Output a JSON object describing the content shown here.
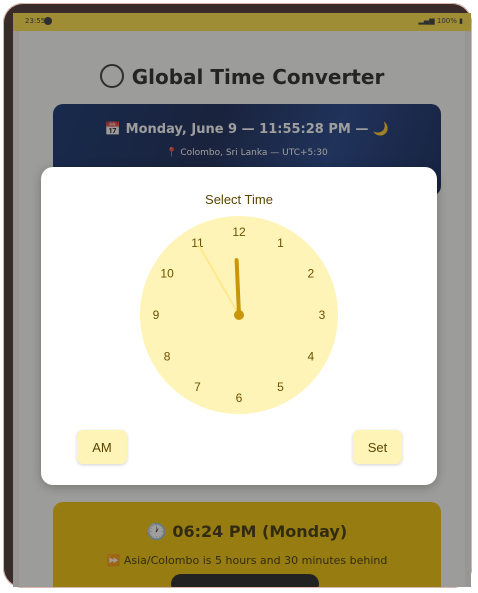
{
  "statusbar": {
    "time": "23:55",
    "battery": "100%"
  },
  "app": {
    "title": "Global Time Converter",
    "hero": {
      "line1": "📅 Monday, June 9 — 11:55:28 PM — 🌙",
      "line2": "📍 Colombo, Sri Lanka — UTC+5:30"
    },
    "result": {
      "line1": "🕐 06:24 PM (Monday)",
      "line2": "⏩ Asia/Colombo is 5 hours and 30 minutes behind"
    }
  },
  "dialog": {
    "title": "Select Time",
    "numbers": [
      "12",
      "1",
      "2",
      "3",
      "4",
      "5",
      "6",
      "7",
      "8",
      "9",
      "10",
      "11"
    ],
    "selected": {
      "hour": 11,
      "minute": 55
    },
    "am_label": "AM",
    "set_label": "Set"
  },
  "colors": {
    "accent": "#f2c200",
    "clock_face": "#fff4b8",
    "hand": "#c9960a",
    "status_bar": "#ffe040"
  }
}
